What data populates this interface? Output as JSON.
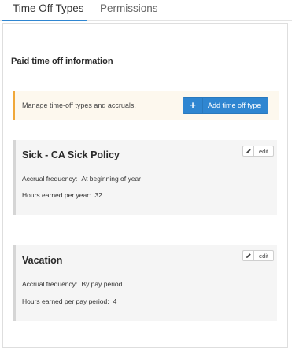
{
  "tabs": [
    {
      "label": "Time Off Types",
      "active": true
    },
    {
      "label": "Permissions",
      "active": false
    }
  ],
  "page": {
    "title": "Paid time off information"
  },
  "banner": {
    "text": "Manage time-off types and accruals.",
    "add_button_icon": "+",
    "add_button_label": "Add time off type"
  },
  "policies": [
    {
      "name": "Sick - CA Sick Policy",
      "edit_label": "edit",
      "fields": [
        {
          "label": "Accrual frequency:",
          "value": "At beginning of year"
        },
        {
          "label": "Hours earned per year:",
          "value": "32"
        }
      ]
    },
    {
      "name": "Vacation",
      "edit_label": "edit",
      "fields": [
        {
          "label": "Accrual frequency:",
          "value": "By pay period"
        },
        {
          "label": "Hours earned per pay period:",
          "value": "4"
        }
      ]
    }
  ],
  "colors": {
    "accent": "#2f86d1",
    "banner_bg": "#fdf8ee",
    "banner_border": "#f0a83a",
    "card_bg": "#f5f5f5"
  },
  "icons": {
    "add": "plus-icon",
    "edit": "pencil-icon"
  }
}
